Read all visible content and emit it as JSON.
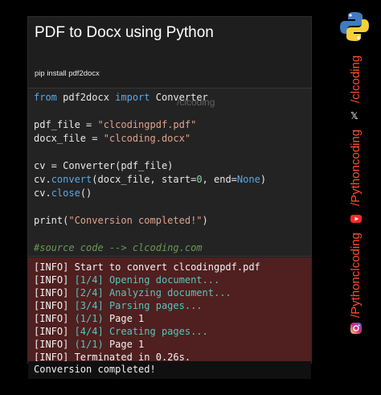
{
  "card": {
    "title": "PDF to Docx using Python",
    "subtitle": "pip install pdf2docx"
  },
  "code": {
    "line1": [
      "from",
      " pdf2docx ",
      "import",
      " Converter"
    ],
    "line3": [
      "pdf_file = ",
      "\"clcodingpdf.pdf\""
    ],
    "line4": [
      "docx_file = ",
      "\"clcoding.docx\""
    ],
    "line6": [
      "cv = Converter(pdf_file)"
    ],
    "line7": [
      "cv.",
      "convert",
      "(docx_file, start=",
      "0",
      ", end=",
      "None",
      ")"
    ],
    "line8": [
      "cv.",
      "close",
      "()"
    ],
    "line10": [
      "print(",
      "\"Conversion completed!\"",
      ")"
    ],
    "comment": "#source code --> clcoding.com",
    "watermark": "/clcoding"
  },
  "output": {
    "prefix": "[INFO] ",
    "lines": [
      {
        "tag": "",
        "text": "Start to convert clcodingpdf.pdf"
      },
      {
        "tag": "[1/4] ",
        "text": "Opening document..."
      },
      {
        "tag": "[2/4] ",
        "text": "Analyzing document..."
      },
      {
        "tag": "[3/4] ",
        "text": "Parsing pages..."
      },
      {
        "tag": "(1/1) ",
        "text": "Page 1"
      },
      {
        "tag": "[4/4] ",
        "text": "Creating pages..."
      },
      {
        "tag": "(1/1) ",
        "text": "Page 1"
      },
      {
        "tag": "",
        "text": "Terminated in 0.26s."
      }
    ],
    "completed": "Conversion completed!"
  },
  "sidebar": {
    "handle1": "/clcoding",
    "handle2": "/Pythoncoding",
    "handle3": "/Pythonclcoding",
    "x_glyph": "𝕏",
    "icons": [
      "python-logo-icon",
      "x-icon",
      "youtube-icon",
      "instagram-icon"
    ],
    "accent": "#ff4d2e"
  }
}
